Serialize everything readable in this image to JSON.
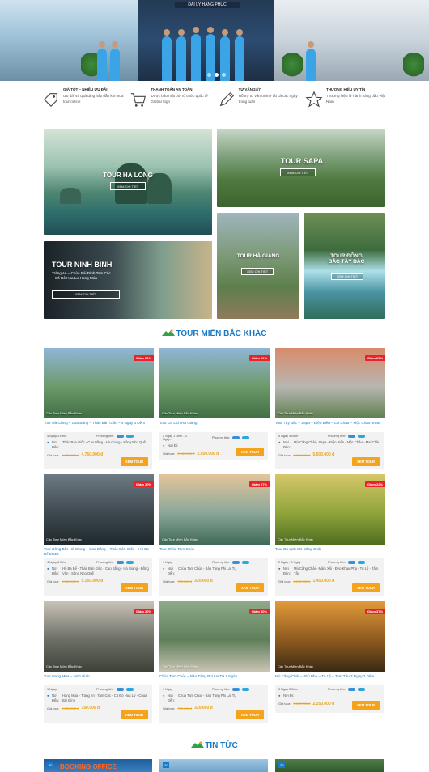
{
  "hero": {
    "sign_text": "ĐẠI LÝ HÀNG PHÚC",
    "slides": 3,
    "active_slide": 1
  },
  "features": [
    {
      "icon": "tag-icon",
      "title": "GIÁ TỐT – NHIỀU ƯU ĐÃI",
      "desc": "Ưu đãi và quà tặng hấp dẫn khi mua tour online"
    },
    {
      "icon": "cart-icon",
      "title": "THANH TOÁN AN TOÀN",
      "desc": "Được bảo mật bởi tổ chức quốc tế Global Sign"
    },
    {
      "icon": "pen-icon",
      "title": "TƯ VẤN 24/7",
      "desc": "Hỗ trợ tư vấn online tất cả các ngày trong tuần"
    },
    {
      "icon": "star-icon",
      "title": "THƯƠNG HIỆU UY TÍN",
      "desc": "Thương hiệu lữ hành hàng đầu Việt Nam"
    }
  ],
  "destinations": {
    "ha_long": {
      "label": "TOUR HẠ LONG",
      "button": "XEM CHI TIẾT"
    },
    "sapa": {
      "label": "TOUR SAPA",
      "button": "XEM CHI TIẾT"
    },
    "ninh_binh": {
      "label": "TOUR NINH BÌNH",
      "sub": "Tràng An – Chùa Bái Đính Tam Cốc – Cố Đô Hoa Lư Hang Múa",
      "button": "XEM CHI TIẾT"
    },
    "ha_giang": {
      "label": "TOUR HÀ GIANG",
      "button": "XEM CHI TIẾT"
    },
    "dong_bac": {
      "label": "TOUR ĐÔNG BẮC TÂY BẮC",
      "button": "XEM CHI TIẾT"
    }
  },
  "section_tours": {
    "title": "TOUR MIỀN BẮC KHÁC"
  },
  "section_news": {
    "title": "TIN TỨC"
  },
  "labels": {
    "vehicle": "Phương tiện:",
    "departure": "Nơi khởi hành:",
    "destination": "Nơi Đến:",
    "price": "Giá tour:",
    "button": "XEM TOUR",
    "category": "Các Tour Miền Bắc Khác"
  },
  "tours": [
    {
      "discount": "Giảm 20%",
      "name": "Tour Hà Giang – Cao Bằng – Thác Bản Giốc – 4 Ngày 3 Đêm",
      "duration": "4 Ngày 3 Đêm",
      "dest_label": "Nơi Đến:",
      "places": "Thác Bản Giốc - Cao Bằng - Hà Giang - Sông Nho Quế",
      "old_price": "5.870.000 đ",
      "new_price": "4.750.000 đ",
      "colors": [
        "#8fb6d6",
        "#6d9a6a",
        "#3f6e44"
      ]
    },
    {
      "discount": "Giảm 20%",
      "name": "Tour Du Lịch Hà Giang",
      "duration": "2 Ngày 1 Đêm - 3 Ngày...",
      "dest_label": "Nơi Đi:",
      "places": "",
      "old_price": "2.960.000 đ",
      "new_price": "2.550.000 đ",
      "colors": [
        "#8fb6d6",
        "#6d9a6a",
        "#3f6e44"
      ]
    },
    {
      "discount": "Giảm 20%",
      "name": "Tour Tây Bắc – Sapa – Điện Biên – Lai Châu – Mộc Châu 3N4Đ",
      "duration": "5 Ngày 4 Đêm",
      "dest_label": "Nơi Đến:",
      "places": "Mù Căng Chải - Sapa - Điện Biên - Mộc Châu - Mai Châu",
      "old_price": "7.950.000 đ",
      "new_price": "5.600.000 đ",
      "colors": [
        "#d98b6a",
        "#b7b7b2",
        "#5e7f4e"
      ]
    },
    {
      "discount": "Giảm 20%",
      "name": "Tour Đông Bắc Hà Giang – Cao Bằng – Thác Bản Giốc – Hồ Ba Bể 5N4Đ",
      "duration": "4 Ngày 3 Đêm",
      "dest_label": "Nơi Đến:",
      "places": "Hồ Ba Bể - Thác Bản Giốc - Cao Bằng - Hà Giang - Đồng Văn - Sông Nho Quế",
      "old_price": "6.960.000 đ",
      "new_price": "5.150.000 đ",
      "colors": [
        "#6f7b84",
        "#3e4a4f",
        "#1f282c"
      ]
    },
    {
      "discount": "Giảm 27%",
      "name": "Tour Chùa Tam Chúc",
      "duration": "1 Ngày",
      "dest_label": "Nơi Đến:",
      "places": "Chùa Tam Chúc - Bảo Tàng Phi Lai Tự",
      "old_price": "750.000 đ",
      "new_price": "320.000 đ",
      "colors": [
        "#e4c59a",
        "#8aa79a",
        "#3f6a55"
      ]
    },
    {
      "discount": "Giảm 22%",
      "name": "Tour Du Lịch Mù Căng Chải",
      "duration": "2 Ngày - 3 Ngày",
      "dest_label": "Nơi Đến:",
      "places": "Mù Căng Chải - Mâm Xôi - Đèo Khau Phạ - Tú Lệ - Tâm Tấu",
      "old_price": "2.150.000 đ",
      "new_price": "1.450.000 đ",
      "colors": [
        "#d6c76a",
        "#8fa53a",
        "#4f6d21"
      ]
    },
    {
      "discount": "Giảm 20%",
      "name": "Tour Hang Múa – Ninh Bình",
      "duration": "1 Ngày",
      "dest_label": "Nơi Đến:",
      "places": "Hang Múa - Tràng An - Tam Cốc - Cố Đô Hoa Lư - Chùa Bái Đính",
      "old_price": "1.350.000 đ",
      "new_price": "750.000 đ",
      "colors": [
        "#c9c2b7",
        "#6b6f65",
        "#3e4138"
      ]
    },
    {
      "discount": "Giảm 30%",
      "name": "Chùa Tam Chúc – Bảo Tàng Phi Lai Tự 1 Ngày",
      "duration": "1 Ngày",
      "dest_label": "Nơi Đến:",
      "places": "Chùa Tam Chúc - Bảo Tàng Phi Lai Tự",
      "old_price": "750.000 đ",
      "new_price": "320.000 đ",
      "colors": [
        "#8faa8a",
        "#5f7f5a",
        "#c9c4b4"
      ]
    },
    {
      "discount": "Giảm 37%",
      "name": "Mù Căng Chải – Phù Phạ – Tú Lệ – Tam Tấu 3 Ngày 2 Đêm",
      "duration": "3 Ngày 2 Đêm",
      "dest_label": "Nơi Đi:",
      "places": "",
      "old_price": "3.650.000 đ",
      "new_price": "2.250.000 đ",
      "colors": [
        "#e39a3a",
        "#8d5a1f",
        "#3a2a14"
      ]
    }
  ],
  "news": [
    {
      "date": "30",
      "caption": "BOOKING OFFICE"
    },
    {
      "date": "30",
      "caption": ""
    },
    {
      "date": "30",
      "caption": ""
    }
  ]
}
